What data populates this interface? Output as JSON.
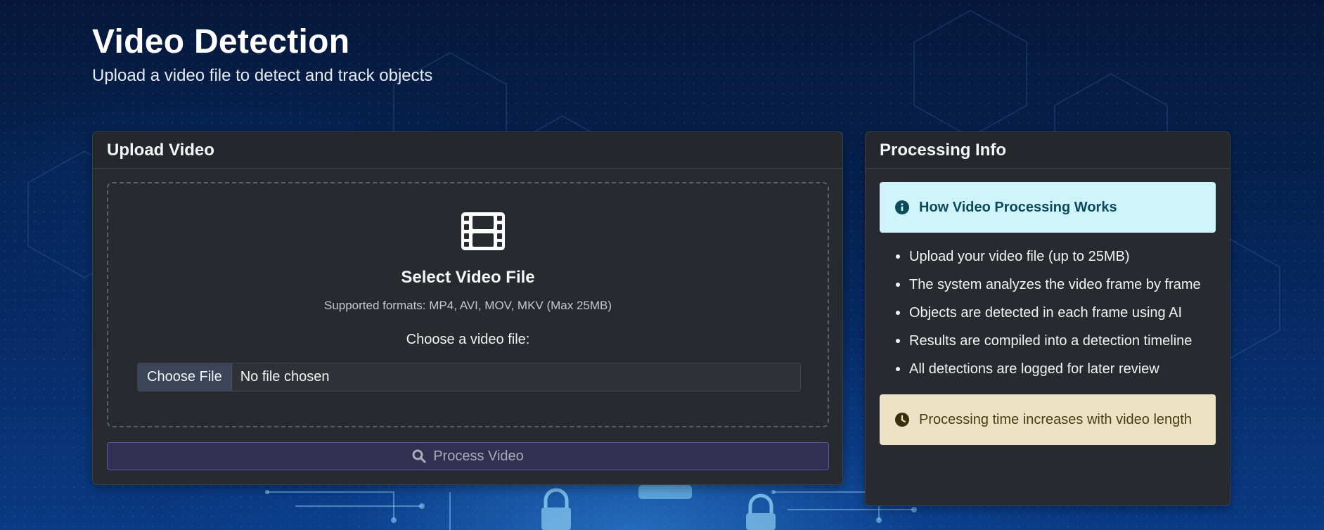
{
  "page": {
    "title": "Video Detection",
    "subtitle": "Upload a video file to detect and track objects"
  },
  "upload": {
    "header": "Upload Video",
    "icon": "film-icon",
    "select_title": "Select Video File",
    "formats": "Supported formats: MP4, AVI, MOV, MKV (Max 25MB)",
    "choose_label": "Choose a video file:",
    "file_button": "Choose File",
    "file_status": "No file chosen",
    "process_button": "Process Video",
    "process_icon": "search-icon"
  },
  "info": {
    "header": "Processing Info",
    "alert_title": "How Video Processing Works",
    "alert_icon": "info-circle-icon",
    "items": [
      "Upload your video file (up to 25MB)",
      "The system analyzes the video frame by frame",
      "Objects are detected in each frame using AI",
      "Results are compiled into a detection timeline",
      "All detections are logged for later review"
    ],
    "warning": "Processing time increases with video length",
    "warning_icon": "clock-icon"
  },
  "colors": {
    "card_bg": "#272a2f",
    "info_alert_bg": "#cff4fc",
    "warning_alert_bg": "#ece3c6",
    "process_button_bg": "#312f52"
  }
}
